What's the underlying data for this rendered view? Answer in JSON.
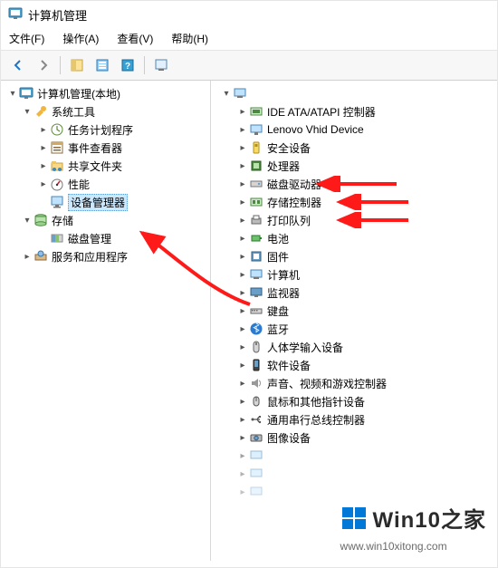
{
  "window": {
    "title": "计算机管理"
  },
  "menu": {
    "file": "文件(F)",
    "action": "操作(A)",
    "view": "查看(V)",
    "help": "帮助(H)"
  },
  "left_tree": {
    "root": "计算机管理(本地)",
    "system_tools": "系统工具",
    "task_scheduler": "任务计划程序",
    "event_viewer": "事件查看器",
    "shared_folders": "共享文件夹",
    "performance": "性能",
    "device_manager": "设备管理器",
    "storage": "存储",
    "disk_management": "磁盘管理",
    "services_apps": "服务和应用程序"
  },
  "right_tree": {
    "computer_root": "",
    "ide_ata": "IDE ATA/ATAPI 控制器",
    "lenovo_vhid": "Lenovo Vhid Device",
    "security_devices": "安全设备",
    "processors": "处理器",
    "disk_drives": "磁盘驱动器",
    "storage_controllers": "存储控制器",
    "print_queues": "打印队列",
    "batteries": "电池",
    "firmware": "固件",
    "computer": "计算机",
    "monitors": "监视器",
    "keyboards": "键盘",
    "bluetooth": "蓝牙",
    "hid": "人体学输入设备",
    "software_devices": "软件设备",
    "sound_video_game": "声音、视频和游戏控制器",
    "mice_pointing": "鼠标和其他指针设备",
    "usb_controllers": "通用串行总线控制器",
    "imaging_devices": "图像设备"
  },
  "watermark": {
    "brand": "Win10之家",
    "url": "www.win10xitong.com"
  },
  "colors": {
    "arrow": "#ff1a1a",
    "selection": "#cce8ff",
    "win_blue": "#0078d7"
  }
}
